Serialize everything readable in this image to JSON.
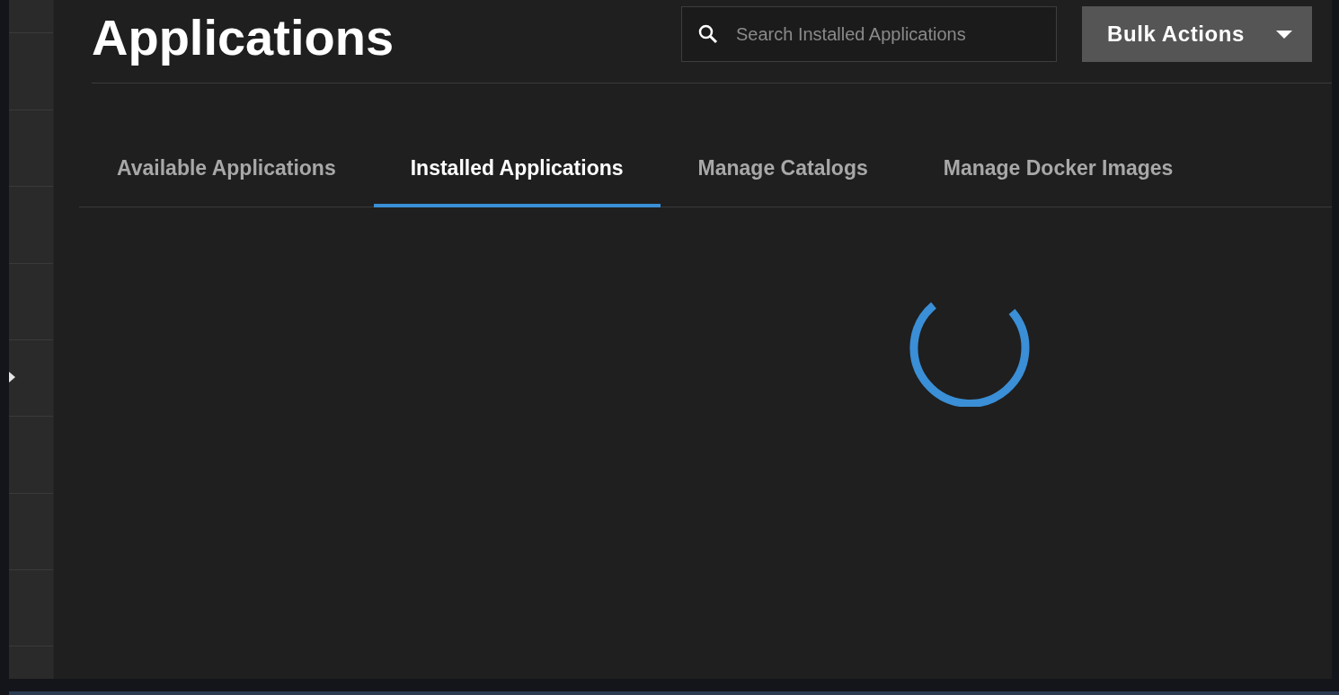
{
  "page": {
    "title": "Applications"
  },
  "search": {
    "placeholder": "Search Installed Applications"
  },
  "bulk_actions": {
    "label": "Bulk Actions"
  },
  "tabs": [
    {
      "label": "Available Applications",
      "selected": false
    },
    {
      "label": "Installed Applications",
      "selected": true
    },
    {
      "label": "Manage Catalogs",
      "selected": false
    },
    {
      "label": "Manage Docker Images",
      "selected": false
    }
  ]
}
